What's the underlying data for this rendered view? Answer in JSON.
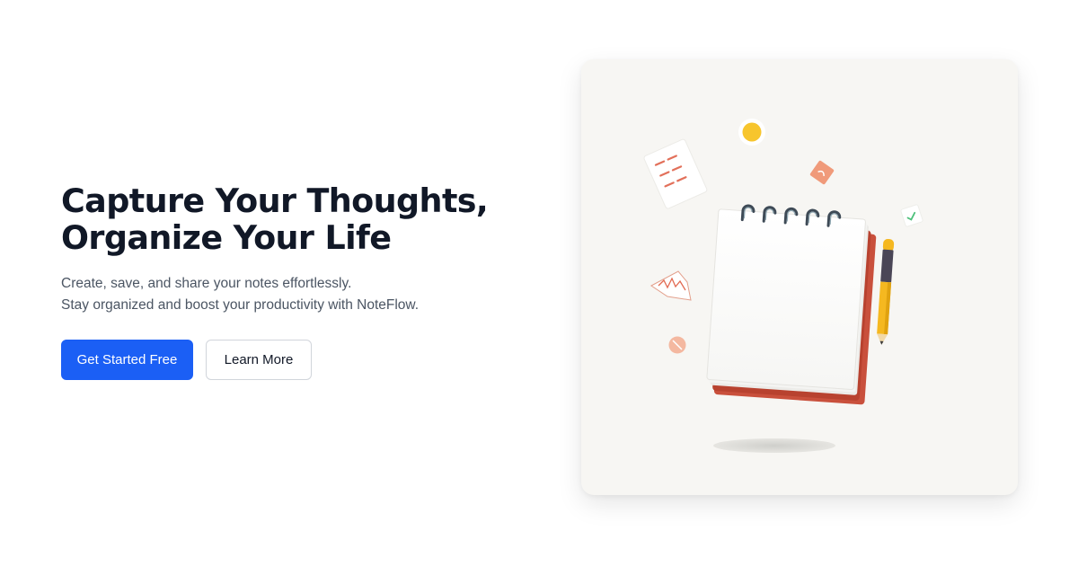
{
  "hero": {
    "headline_line1": "Capture Your Thoughts,",
    "headline_line2": "Organize Your Life",
    "subtext_line1": "Create, save, and share your notes effortlessly.",
    "subtext_line2": "Stay organized and boost your productivity with NoteFlow.",
    "primary_cta": "Get Started Free",
    "secondary_cta": "Learn More"
  },
  "colors": {
    "primary": "#1b5ff5",
    "heading": "#111827",
    "body_text": "#4b5563",
    "notebook_cover": "#c9503c",
    "pencil": "#f5b820",
    "sun": "#f7c52d"
  },
  "illustration": {
    "subject": "spiral notebook with pencil and floating sticky notes"
  }
}
